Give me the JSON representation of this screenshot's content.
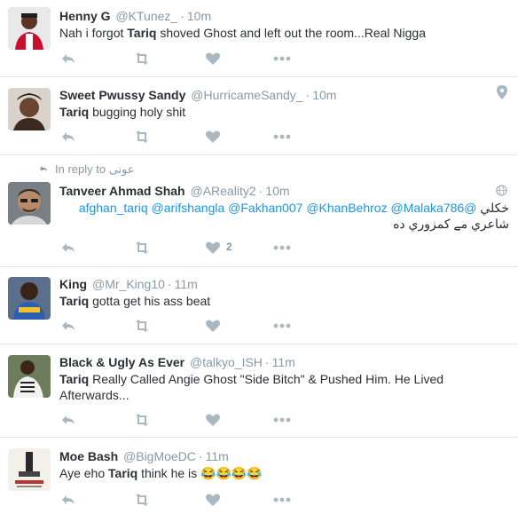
{
  "tweets": [
    {
      "fullname": "Henny G",
      "username": "@KTunez_",
      "time": "10m",
      "text_pre": "Nah i forgot ",
      "bold": "Tariq",
      "text_post": " shoved Ghost and left out the room...Real Nigga"
    },
    {
      "fullname": "Sweet Pwussy Sandy",
      "username": "@HurricameSandy_",
      "time": "10m",
      "bold": "Tariq",
      "text_post": " bugging holy shit"
    },
    {
      "in_reply_label": "In reply to",
      "in_reply_name": "عونی",
      "fullname": "Tanveer Ahmad Shah",
      "username": "@AReality2",
      "time": "10m",
      "line1_rtl_word": "خکلي",
      "mentions": [
        "@afghan_tariq",
        "@arifshangla",
        "@Fakhan007",
        "@KhanBehroz",
        "@Malaka786"
      ],
      "line2_rtl": "شاعري مے کمزوري ده",
      "like_count": "2"
    },
    {
      "fullname": "King",
      "username": "@Mr_King10",
      "time": "11m",
      "bold": "Tariq",
      "text_post": " gotta get his ass beat"
    },
    {
      "fullname": "Black & Ugly As Ever",
      "username": "@talkyo_ISH",
      "time": "11m",
      "bold": "Tariq",
      "text_post": " Really Called Angie Ghost \"Side Bitch\" & Pushed Him. He Lived Afterwards..."
    },
    {
      "fullname": "Moe Bash",
      "username": "@BigMoeDC",
      "time": "11m",
      "text_pre": "Aye eho ",
      "bold": "Tariq",
      "text_post": " think he is ",
      "emoji": "😂😂😂😂"
    }
  ],
  "icons": {
    "reply": "reply-icon",
    "retweet": "retweet-icon",
    "like": "heart-icon",
    "more": "more-icon",
    "location": "location-pin-icon",
    "globe": "globe-icon"
  },
  "colors": {
    "name": "#292f33",
    "meta": "#8899a6",
    "link": "#1b95e0",
    "icon": "#aab8c2",
    "divider": "#e1e8ed"
  }
}
